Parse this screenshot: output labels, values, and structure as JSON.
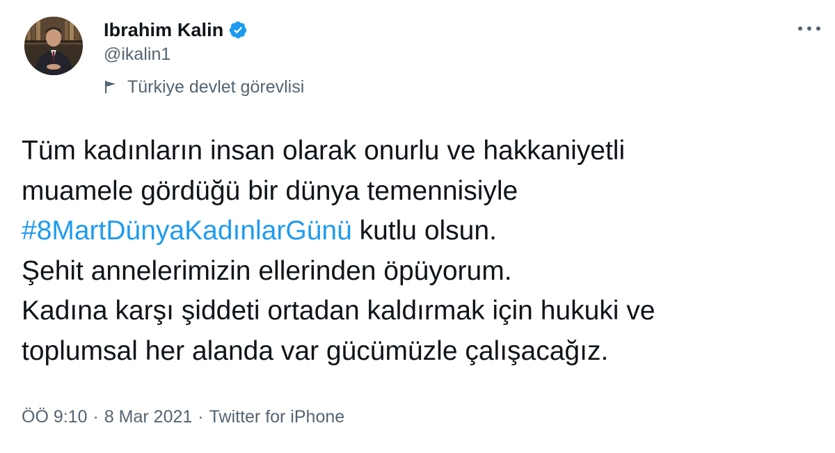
{
  "author": {
    "display_name": "Ibrahim Kalin",
    "handle": "@ikalin1",
    "label": "Türkiye devlet görevlisi",
    "verified": true
  },
  "tweet": {
    "line1": "Tüm kadınların insan olarak onurlu ve hakkaniyetli",
    "line2": "muamele gördüğü bir dünya temennisiyle",
    "hashtag": "#8MartDünyaKadınlarGünü",
    "line3_rest": " kutlu olsun.",
    "line4": "Şehit annelerimizin ellerinden öpüyorum.",
    "line5": "Kadına karşı şiddeti ortadan kaldırmak için hukuki ve",
    "line6": "toplumsal her alanda var gücümüzle çalışacağız."
  },
  "meta": {
    "time": "ÖÖ 9:10",
    "separator": "·",
    "date": "8 Mar 2021",
    "source": "Twitter for iPhone"
  },
  "icons": {
    "verified": "verified-badge-icon",
    "label": "flag-icon",
    "more": "more-dots-icon"
  },
  "colors": {
    "link": "#1d9bf0",
    "secondary_text": "#536471",
    "primary_text": "#0f1419"
  }
}
